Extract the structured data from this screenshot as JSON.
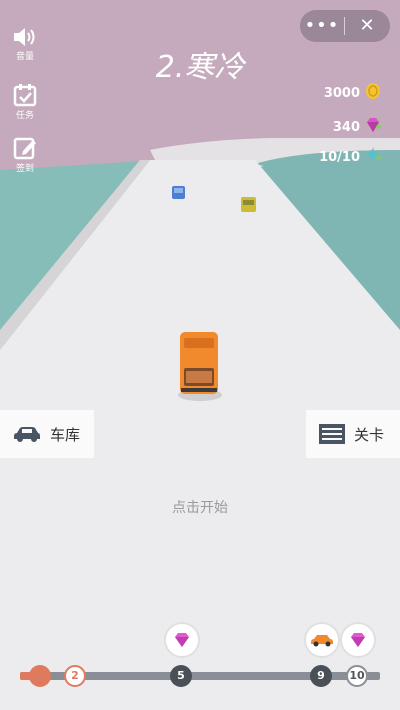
{
  "hud": {
    "sound_label": "音量",
    "tasks_label": "任务",
    "signin_label": "签到",
    "more_label": "•••",
    "close_label": "✕"
  },
  "level_title": "2.寒冷",
  "resources": {
    "coins": "3000",
    "gems": "340",
    "energy": "10/10"
  },
  "buttons": {
    "garage_label": "车库",
    "levels_label": "关卡"
  },
  "start_hint": "点击开始",
  "progress": {
    "fill_fraction": 0.06,
    "node_current": "2",
    "node_5": "5",
    "node_9": "9",
    "node_10": "10"
  },
  "colors": {
    "sky": "#c3a9bb",
    "water": "#7fb8b6",
    "road": "#ececee",
    "player_car": "#f08a2c",
    "accent": "#e07a5f"
  }
}
